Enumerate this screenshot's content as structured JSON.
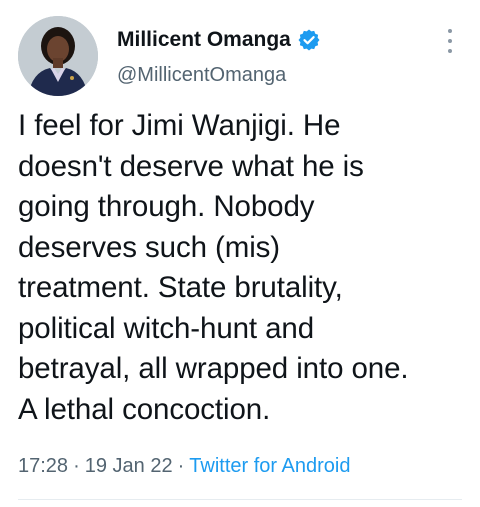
{
  "tweet": {
    "display_name": "Millicent Omanga",
    "verified": true,
    "handle": "@MillicentOmanga",
    "text": "I feel for Jimi Wanjigi. He\ndoesn't deserve what he is\ngoing through. Nobody\ndeserves such (mis)\ntreatment. State brutality,\npolitical witch-hunt and\nbetrayal, all wrapped into one.\nA lethal concoction.",
    "time": "17:28",
    "date": "19 Jan 22",
    "separator": "·",
    "source": "Twitter for Android"
  },
  "icons": {
    "verified": "verified-badge-icon",
    "more": "more-vertical-icon"
  },
  "colors": {
    "text": "#0f1419",
    "secondary": "#536471",
    "accent": "#1d9bf0",
    "divider": "#e6ecf0"
  }
}
